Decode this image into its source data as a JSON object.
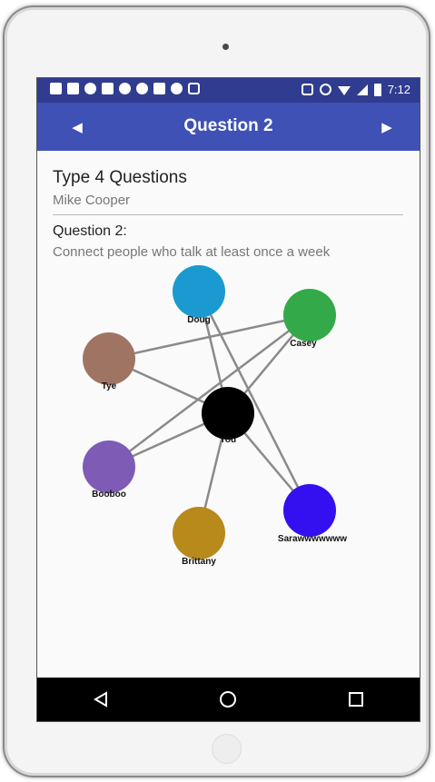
{
  "status_bar": {
    "time": "7:12"
  },
  "app_bar": {
    "title": "Question 2",
    "prev_glyph": "◀",
    "next_glyph": "▶"
  },
  "survey": {
    "title": "Type 4 Questions",
    "respondent": "Mike Cooper",
    "question_number": "Question 2:",
    "question_text": "Connect people who talk at least once a week"
  },
  "network": {
    "nodes": [
      {
        "id": "doug",
        "label": "Doug",
        "color": "#1a9ad0"
      },
      {
        "id": "casey",
        "label": "Casey",
        "color": "#34a94a"
      },
      {
        "id": "tye",
        "label": "Tye",
        "color": "#a07463"
      },
      {
        "id": "you",
        "label": "You",
        "color": "#000000"
      },
      {
        "id": "booboo",
        "label": "Booboo",
        "color": "#7e5bb5"
      },
      {
        "id": "sarawww",
        "label": "Sarawwwwwww",
        "color": "#3410f0"
      },
      {
        "id": "brittany",
        "label": "Brittany",
        "color": "#b8891b"
      }
    ],
    "edges": [
      [
        "tye",
        "casey"
      ],
      [
        "tye",
        "you"
      ],
      [
        "booboo",
        "casey"
      ],
      [
        "booboo",
        "you"
      ],
      [
        "doug",
        "you"
      ],
      [
        "doug",
        "sarawww"
      ],
      [
        "you",
        "casey"
      ],
      [
        "you",
        "sarawww"
      ],
      [
        "you",
        "brittany"
      ]
    ],
    "edge_color": "#8a8a8a"
  },
  "nav_bar": {
    "back": "back-icon",
    "home": "home-icon",
    "recents": "recents-icon"
  }
}
